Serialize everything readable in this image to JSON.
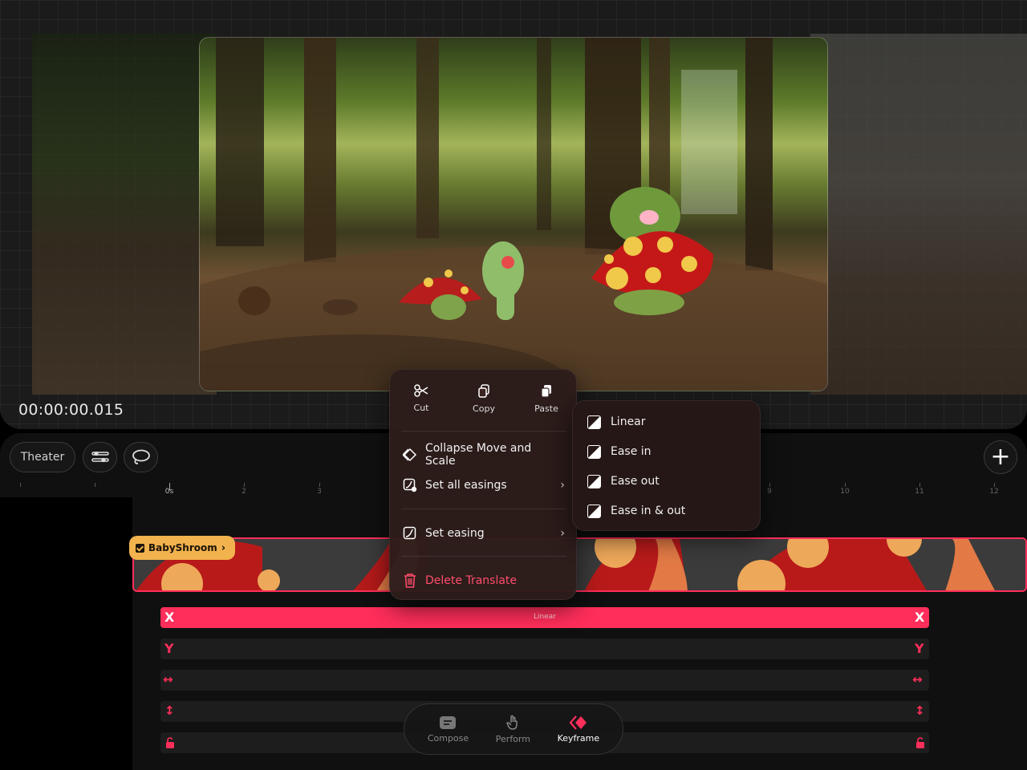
{
  "preview": {
    "timecode": "00:00:00.015"
  },
  "toolbar": {
    "theater_label": "Theater",
    "add_icon": "plus-icon"
  },
  "ruler": {
    "labels": [
      "0s",
      "2",
      "3",
      "9",
      "10",
      "11",
      "12"
    ]
  },
  "track": {
    "name": "BabyShroom",
    "checked": true
  },
  "lanes": [
    {
      "key": "X",
      "active": true,
      "easing_label": "Linear"
    },
    {
      "key": "Y",
      "active": false
    },
    {
      "key": "↔",
      "active": false
    },
    {
      "key": "↕",
      "active": false
    },
    {
      "key": "lock",
      "active": false
    }
  ],
  "context_menu": {
    "cut": "Cut",
    "copy": "Copy",
    "paste": "Paste",
    "collapse": "Collapse Move and Scale",
    "set_all_easings": "Set all easings",
    "set_easing": "Set easing",
    "delete": "Delete Translate"
  },
  "easing_submenu": {
    "items": [
      "Linear",
      "Ease in",
      "Ease out",
      "Ease in & out"
    ]
  },
  "dock": {
    "compose": "Compose",
    "perform": "Perform",
    "keyframe": "Keyframe",
    "selected": "Keyframe"
  },
  "colors": {
    "accent": "#ff2e5a",
    "badge": "#f2b34e",
    "background": "#101010"
  }
}
